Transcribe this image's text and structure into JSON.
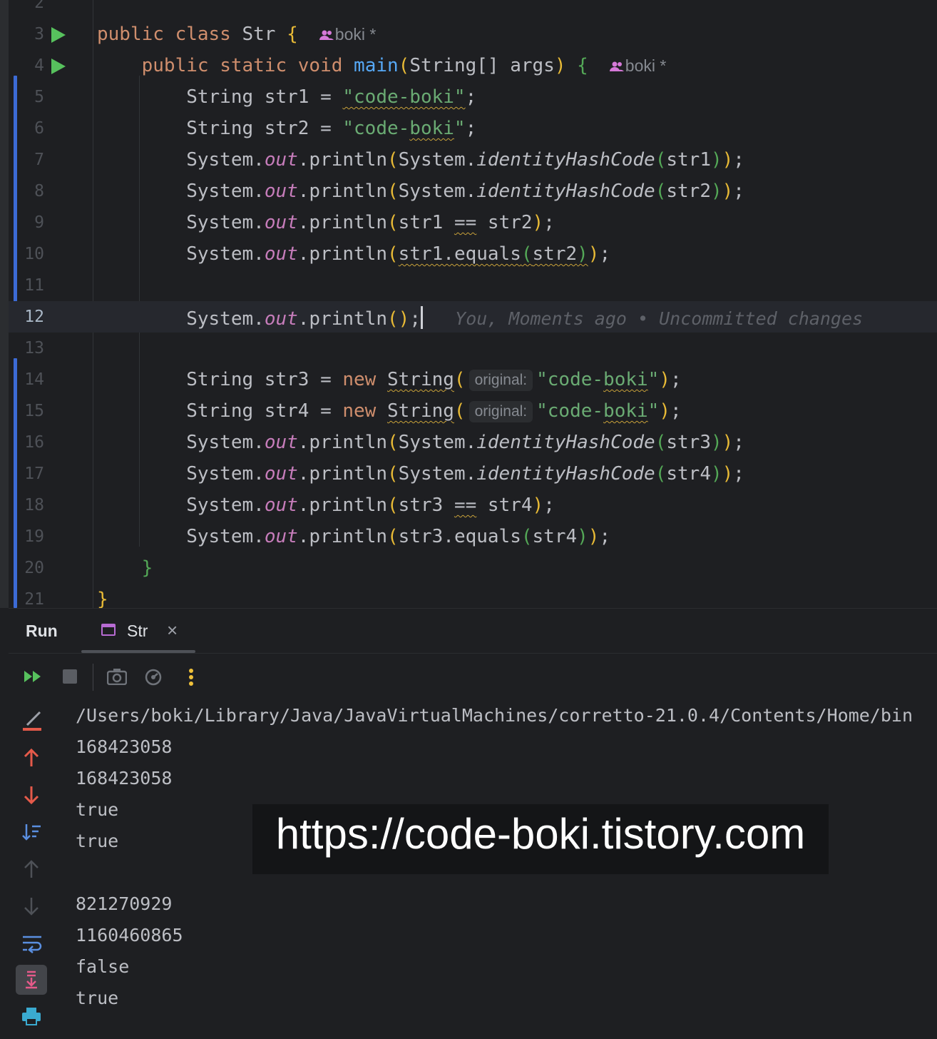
{
  "editor": {
    "lines": [
      {
        "n": "2",
        "segs": []
      },
      {
        "n": "3",
        "run": true,
        "segs": [
          {
            "c": "kw",
            "t": "public class "
          },
          {
            "t": "Str "
          },
          {
            "c": "p1",
            "t": "{"
          },
          {
            "c": "author",
            "t": "  boki *",
            "icon": true
          }
        ]
      },
      {
        "n": "4",
        "run": true,
        "segs": [
          {
            "t": "    "
          },
          {
            "c": "kw",
            "t": "public static void "
          },
          {
            "c": "fn",
            "t": "main"
          },
          {
            "c": "p1",
            "t": "("
          },
          {
            "t": "String[] args"
          },
          {
            "c": "p1",
            "t": ")"
          },
          {
            "t": " "
          },
          {
            "c": "p2",
            "t": "{"
          },
          {
            "c": "author",
            "t": "  boki *",
            "icon": true
          }
        ]
      },
      {
        "n": "5",
        "segs": [
          {
            "t": "        String str1 = "
          },
          {
            "c": "str wavy",
            "t": "\"code-boki\""
          },
          {
            "t": ";"
          }
        ]
      },
      {
        "n": "6",
        "segs": [
          {
            "t": "        String str2 = "
          },
          {
            "c": "str",
            "t": "\"code-"
          },
          {
            "c": "str wavy",
            "t": "boki"
          },
          {
            "c": "str",
            "t": "\""
          },
          {
            "t": ";"
          }
        ]
      },
      {
        "n": "7",
        "segs": [
          {
            "t": "        System."
          },
          {
            "c": "fld",
            "t": "out"
          },
          {
            "t": ".println"
          },
          {
            "c": "p1",
            "t": "("
          },
          {
            "t": "System."
          },
          {
            "c": "sm",
            "t": "identityHashCode"
          },
          {
            "c": "p2",
            "t": "("
          },
          {
            "t": "str1"
          },
          {
            "c": "p2",
            "t": ")"
          },
          {
            "c": "p1",
            "t": ")"
          },
          {
            "t": ";"
          }
        ]
      },
      {
        "n": "8",
        "segs": [
          {
            "t": "        System."
          },
          {
            "c": "fld",
            "t": "out"
          },
          {
            "t": ".println"
          },
          {
            "c": "p1",
            "t": "("
          },
          {
            "t": "System."
          },
          {
            "c": "sm",
            "t": "identityHashCode"
          },
          {
            "c": "p2",
            "t": "("
          },
          {
            "t": "str2"
          },
          {
            "c": "p2",
            "t": ")"
          },
          {
            "c": "p1",
            "t": ")"
          },
          {
            "t": ";"
          }
        ]
      },
      {
        "n": "9",
        "segs": [
          {
            "t": "        System."
          },
          {
            "c": "fld",
            "t": "out"
          },
          {
            "t": ".println"
          },
          {
            "c": "p1",
            "t": "("
          },
          {
            "t": "str1 "
          },
          {
            "c": "wavy",
            "t": "=="
          },
          {
            "t": " str2"
          },
          {
            "c": "p1",
            "t": ")"
          },
          {
            "t": ";"
          }
        ]
      },
      {
        "n": "10",
        "segs": [
          {
            "t": "        System."
          },
          {
            "c": "fld",
            "t": "out"
          },
          {
            "t": ".println"
          },
          {
            "c": "p1",
            "t": "("
          },
          {
            "c": "wavy",
            "t": "str1.equals"
          },
          {
            "c": "p2 wavy",
            "t": "("
          },
          {
            "c": "wavy",
            "t": "str2"
          },
          {
            "c": "p2 wavy",
            "t": ")"
          },
          {
            "c": "p1",
            "t": ")"
          },
          {
            "t": ";"
          }
        ]
      },
      {
        "n": "11",
        "segs": []
      },
      {
        "n": "12",
        "current": true,
        "segs": [
          {
            "t": "        System."
          },
          {
            "c": "fld",
            "t": "out"
          },
          {
            "t": ".println"
          },
          {
            "c": "p1",
            "t": "()"
          },
          {
            "t": ";"
          },
          {
            "c": "caret",
            "t": ""
          },
          {
            "c": "blame",
            "t": "   You, Moments ago • Uncommitted changes"
          }
        ]
      },
      {
        "n": "13",
        "segs": []
      },
      {
        "n": "14",
        "segs": [
          {
            "t": "        String str3 = "
          },
          {
            "c": "kw",
            "t": "new "
          },
          {
            "c": "wavy",
            "t": "String"
          },
          {
            "c": "p1",
            "t": "("
          },
          {
            "c": "hint",
            "t": "original:"
          },
          {
            "c": "str",
            "t": "\"code-"
          },
          {
            "c": "str wavy",
            "t": "boki"
          },
          {
            "c": "str",
            "t": "\""
          },
          {
            "c": "p1",
            "t": ")"
          },
          {
            "t": ";"
          }
        ]
      },
      {
        "n": "15",
        "segs": [
          {
            "t": "        String str4 = "
          },
          {
            "c": "kw",
            "t": "new "
          },
          {
            "c": "wavy",
            "t": "String"
          },
          {
            "c": "p1",
            "t": "("
          },
          {
            "c": "hint",
            "t": "original:"
          },
          {
            "c": "str",
            "t": "\"code-"
          },
          {
            "c": "str wavy",
            "t": "boki"
          },
          {
            "c": "str",
            "t": "\""
          },
          {
            "c": "p1",
            "t": ")"
          },
          {
            "t": ";"
          }
        ]
      },
      {
        "n": "16",
        "segs": [
          {
            "t": "        System."
          },
          {
            "c": "fld",
            "t": "out"
          },
          {
            "t": ".println"
          },
          {
            "c": "p1",
            "t": "("
          },
          {
            "t": "System."
          },
          {
            "c": "sm",
            "t": "identityHashCode"
          },
          {
            "c": "p2",
            "t": "("
          },
          {
            "t": "str3"
          },
          {
            "c": "p2",
            "t": ")"
          },
          {
            "c": "p1",
            "t": ")"
          },
          {
            "t": ";"
          }
        ]
      },
      {
        "n": "17",
        "segs": [
          {
            "t": "        System."
          },
          {
            "c": "fld",
            "t": "out"
          },
          {
            "t": ".println"
          },
          {
            "c": "p1",
            "t": "("
          },
          {
            "t": "System."
          },
          {
            "c": "sm",
            "t": "identityHashCode"
          },
          {
            "c": "p2",
            "t": "("
          },
          {
            "t": "str4"
          },
          {
            "c": "p2",
            "t": ")"
          },
          {
            "c": "p1",
            "t": ")"
          },
          {
            "t": ";"
          }
        ]
      },
      {
        "n": "18",
        "segs": [
          {
            "t": "        System."
          },
          {
            "c": "fld",
            "t": "out"
          },
          {
            "t": ".println"
          },
          {
            "c": "p1",
            "t": "("
          },
          {
            "t": "str3 "
          },
          {
            "c": "wavy",
            "t": "=="
          },
          {
            "t": " str4"
          },
          {
            "c": "p1",
            "t": ")"
          },
          {
            "t": ";"
          }
        ]
      },
      {
        "n": "19",
        "segs": [
          {
            "t": "        System."
          },
          {
            "c": "fld",
            "t": "out"
          },
          {
            "t": ".println"
          },
          {
            "c": "p1",
            "t": "("
          },
          {
            "t": "str3.equals"
          },
          {
            "c": "p2",
            "t": "("
          },
          {
            "t": "str4"
          },
          {
            "c": "p2",
            "t": ")"
          },
          {
            "c": "p1",
            "t": ")"
          },
          {
            "t": ";"
          }
        ]
      },
      {
        "n": "20",
        "segs": [
          {
            "t": "    "
          },
          {
            "c": "p2",
            "t": "}"
          }
        ]
      },
      {
        "n": "21",
        "segs": [
          {
            "c": "p1",
            "t": "}"
          }
        ]
      }
    ]
  },
  "run_panel": {
    "title": "Run",
    "tab_label": "Str",
    "tab_close": "×",
    "toolbar_icons": [
      "rerun-icon",
      "stop-icon",
      "camera-icon",
      "dump-threads-icon",
      "more-options-icon"
    ],
    "side_icons": [
      "clear-console-icon",
      "up-arrow-icon",
      "down-arrow-icon",
      "sort-icon",
      "scroll-up-icon",
      "scroll-down-icon",
      "soft-wrap-icon",
      "scroll-to-end-icon",
      "print-icon"
    ]
  },
  "console": {
    "lines": [
      "/Users/boki/Library/Java/JavaVirtualMachines/corretto-21.0.4/Contents/Home/bin",
      "168423058",
      "168423058",
      "true",
      "true",
      "",
      "821270929",
      "1160460865",
      "false",
      "true"
    ]
  },
  "watermark": "https://code-boki.tistory.com",
  "colors": {
    "background": "#1e1f22",
    "keyword": "#cf8e6d",
    "string": "#6aab73",
    "function": "#56a8f5",
    "field": "#c77dbb",
    "vcs_marker": "#3c6bd6",
    "run_green": "#57c15d"
  }
}
